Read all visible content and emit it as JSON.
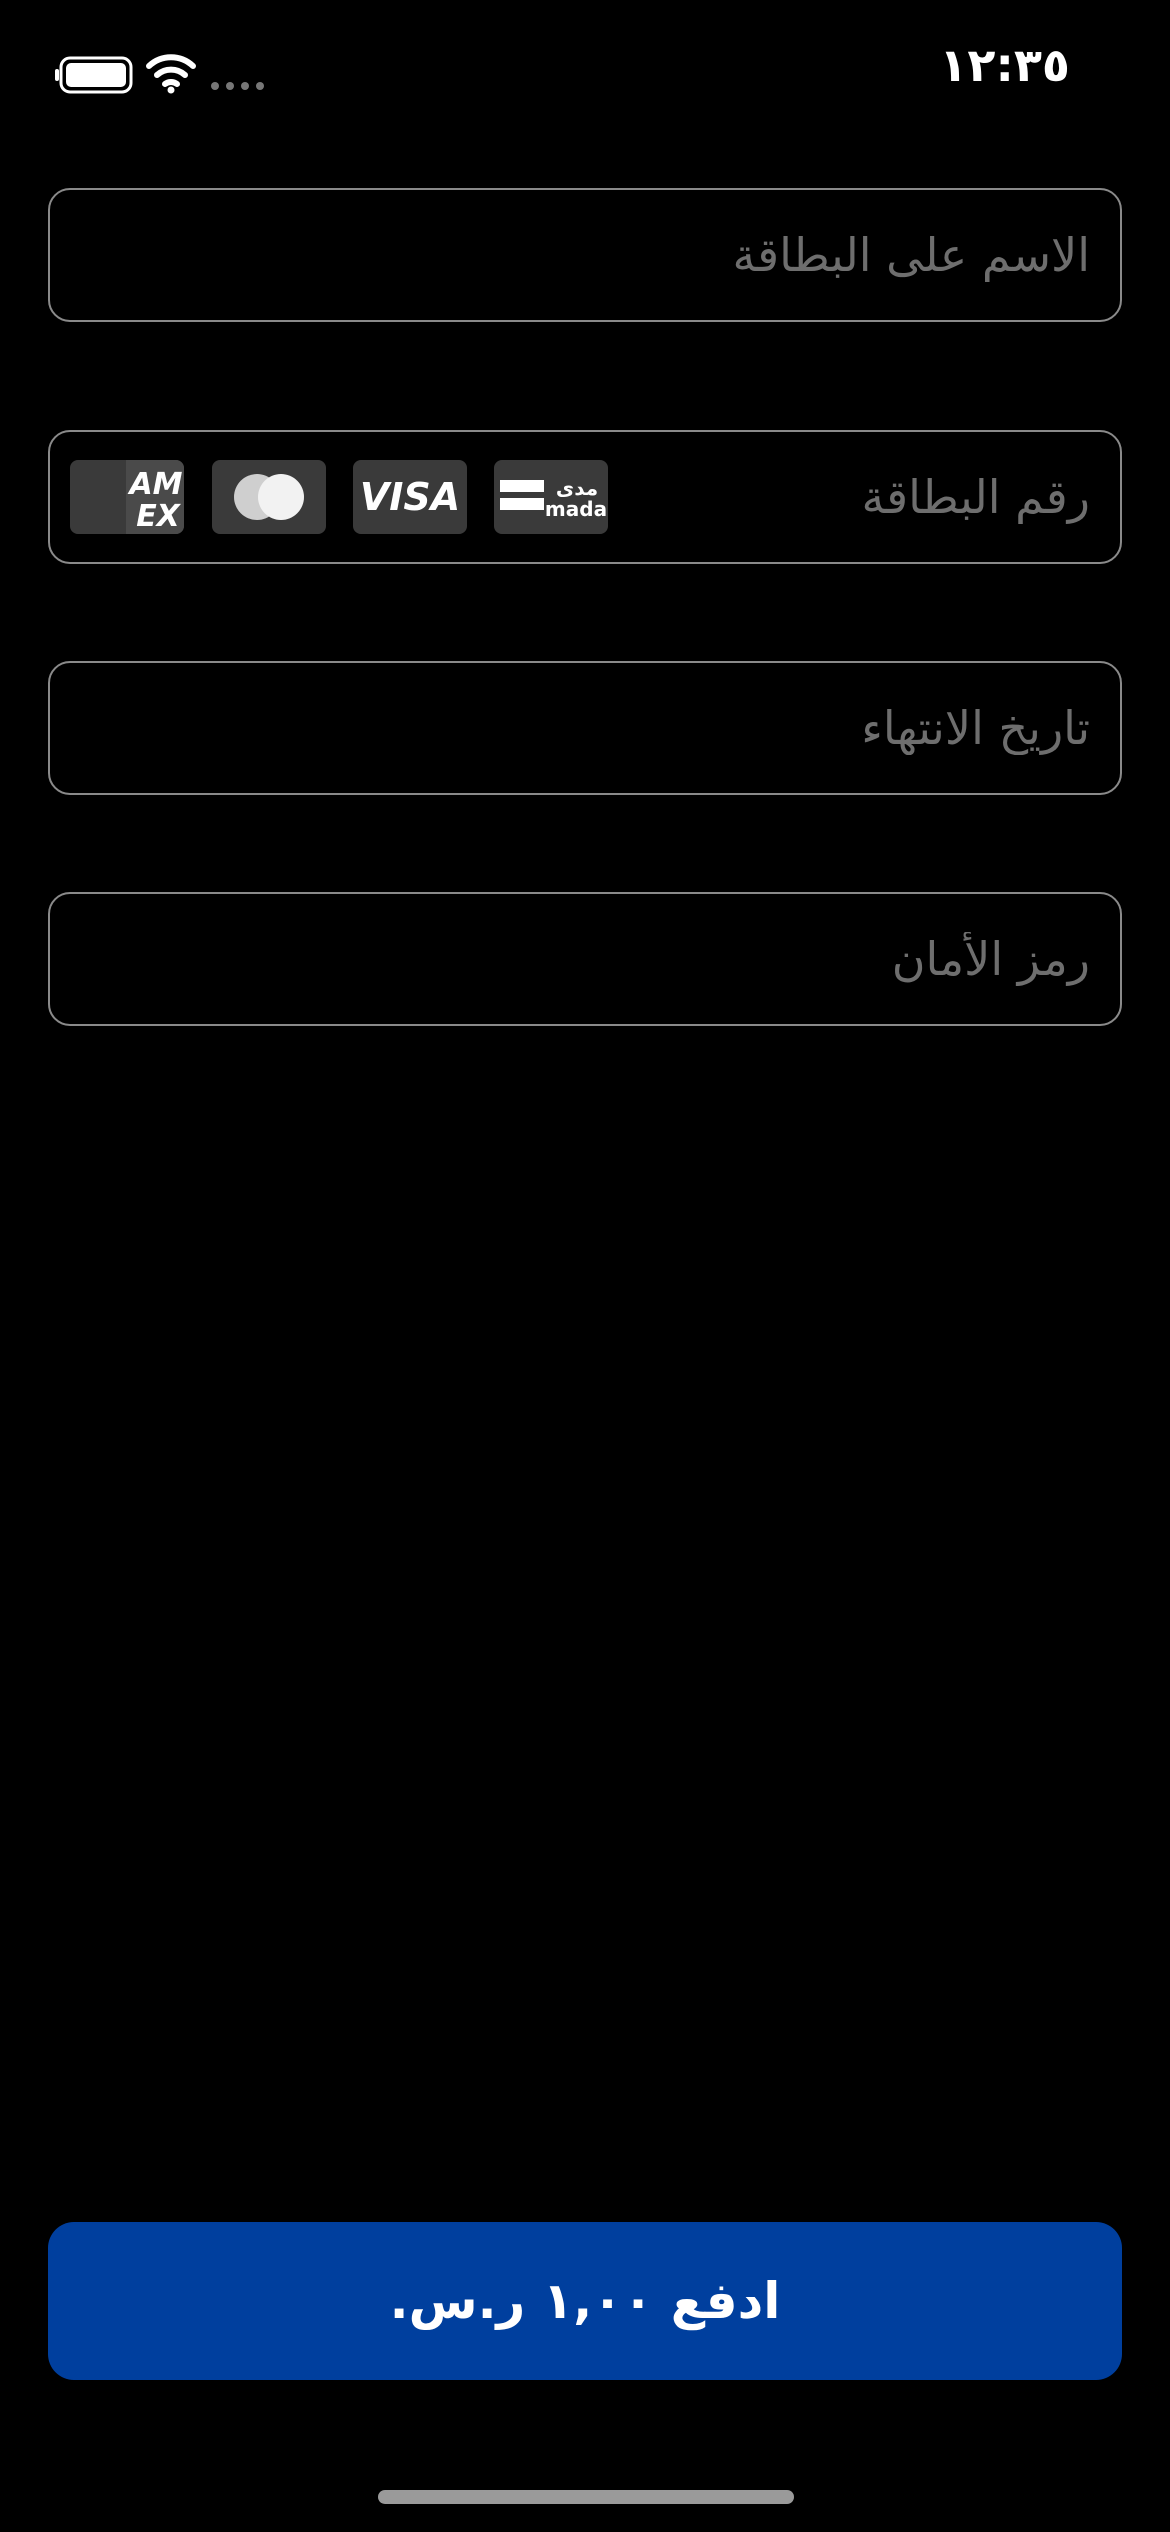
{
  "status_bar": {
    "time": "١٢:٣٥",
    "battery_icon": "battery-full-icon",
    "wifi_icon": "wifi-icon",
    "signal_icon": "cellular-signal-dots-icon"
  },
  "form": {
    "card_name": {
      "placeholder": "الاسم على البطاقة",
      "value": ""
    },
    "card_number": {
      "placeholder": "رقم البطاقة",
      "value": ""
    },
    "expiry": {
      "placeholder": "تاريخ الانتهاء",
      "value": ""
    },
    "security_code": {
      "placeholder": "رمز الأمان",
      "value": ""
    }
  },
  "card_brands": {
    "mada": {
      "arabic": "مدى",
      "latin": "mada"
    },
    "visa": "VISA",
    "mastercard": "mastercard-logo",
    "amex": {
      "top": "AM",
      "bottom": "EX"
    }
  },
  "pay_button": {
    "label": "ادفع ١,٠٠ ر.س."
  },
  "colors": {
    "background": "#000000",
    "field_border": "#8a8a8a",
    "placeholder": "#6e6e6e",
    "pay_button": "#003f9e",
    "logo_background": "#3a3a3a"
  }
}
